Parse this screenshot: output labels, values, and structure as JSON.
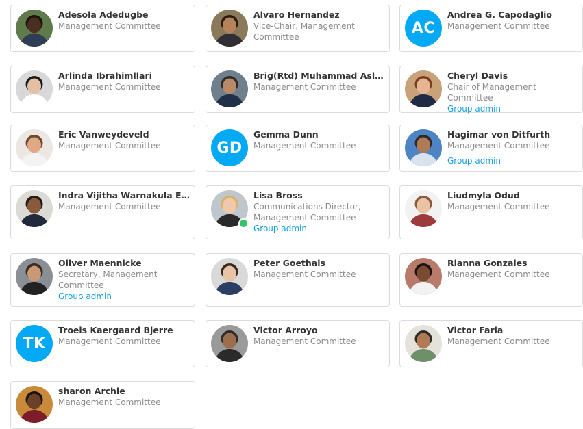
{
  "colors": {
    "accent": "#03a9f4",
    "link": "#1a9fe0",
    "name_text": "#333333",
    "role_text": "#8b8b8b",
    "online": "#36c46b"
  },
  "members": [
    {
      "name": "Adesola Adedugbe",
      "role": "Management Committee",
      "badge": "",
      "initials": "",
      "online": false
    },
    {
      "name": "Alvaro Hernandez",
      "role": "Vice-Chair, Management Committee",
      "badge": "",
      "initials": "",
      "online": false
    },
    {
      "name": "Andrea G. Capodaglio",
      "role": "Management Committee",
      "badge": "",
      "initials": "AC",
      "online": false
    },
    {
      "name": "Arlinda Ibrahimllari",
      "role": "Management Committee",
      "badge": "",
      "initials": "",
      "online": false
    },
    {
      "name": "Brig(Rtd) Muhammad Aslam",
      "role": "Management Committee",
      "badge": "",
      "initials": "",
      "online": false
    },
    {
      "name": "Cheryl Davis",
      "role": "Chair of Management Committee",
      "badge": "Group admin",
      "initials": "",
      "online": false
    },
    {
      "name": "Eric Vanweydeveld",
      "role": "Management Committee",
      "badge": "",
      "initials": "",
      "online": false
    },
    {
      "name": "Gemma Dunn",
      "role": "Management Committee",
      "badge": "",
      "initials": "GD",
      "online": false
    },
    {
      "name": "Hagimar von Ditfurth",
      "role": "Management Committee",
      "badge": "Group admin",
      "initials": "",
      "online": false
    },
    {
      "name": "Indra Vijitha Warnakula Ediri...",
      "role": "Management Committee",
      "badge": "",
      "initials": "",
      "online": false
    },
    {
      "name": "Lisa Bross",
      "role": "Communications Director, Management Committee",
      "badge": "Group admin",
      "initials": "",
      "online": true
    },
    {
      "name": "Liudmyla Odud",
      "role": "Management Committee",
      "badge": "",
      "initials": "",
      "online": false
    },
    {
      "name": "Oliver Maennicke",
      "role": "Secretary, Management Committee",
      "badge": "Group admin",
      "initials": "",
      "online": false
    },
    {
      "name": "Peter Goethals",
      "role": "Management Committee",
      "badge": "",
      "initials": "",
      "online": false
    },
    {
      "name": "Rianna Gonzales",
      "role": "Management Committee",
      "badge": "",
      "initials": "",
      "online": false
    },
    {
      "name": "Troels Kaergaard Bjerre",
      "role": "Management Committee",
      "badge": "",
      "initials": "TK",
      "online": false
    },
    {
      "name": "Victor Arroyo",
      "role": "Management Committee",
      "badge": "",
      "initials": "",
      "online": false
    },
    {
      "name": "Victor Faria",
      "role": "Management Committee",
      "badge": "",
      "initials": "",
      "online": false
    },
    {
      "name": "sharon Archie",
      "role": "Management Committee",
      "badge": "",
      "initials": "",
      "online": false
    }
  ]
}
